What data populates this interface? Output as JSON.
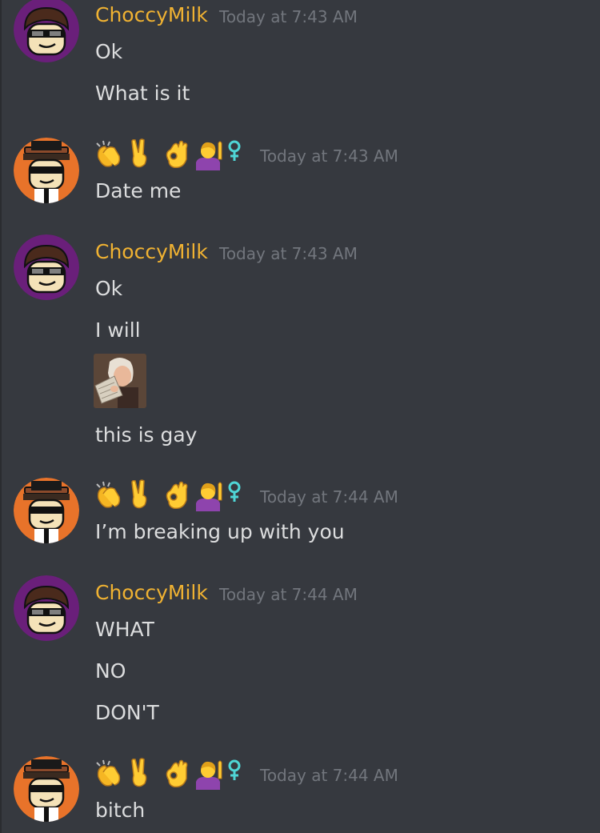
{
  "users": {
    "choccy": {
      "name": "ChoccyMilk",
      "color": "#f0b232"
    },
    "emoji": {
      "name_icons": [
        "clapping-hands",
        "victory-hand",
        "ok-hand",
        "person-raising-hand",
        "female-sign"
      ]
    }
  },
  "groups": [
    {
      "author": "ChoccyMilk",
      "time": "Today at 7:43 AM",
      "lines": [
        "Ok",
        "What is it"
      ]
    },
    {
      "time": "Today at 7:43 AM",
      "lines": [
        "Date me"
      ]
    },
    {
      "author": "ChoccyMilk",
      "time": "Today at 7:43 AM",
      "lines": [
        "Ok",
        "I will",
        "this is gay"
      ]
    },
    {
      "time": "Today at 7:44 AM",
      "lines": [
        "I’m breaking up with you"
      ]
    },
    {
      "author": "ChoccyMilk",
      "time": "Today at 7:44 AM",
      "lines": [
        "WHAT",
        "NO",
        "DON'T"
      ]
    },
    {
      "time": "Today at 7:44 AM",
      "lines": [
        "bitch"
      ]
    }
  ],
  "colors": {
    "background": "#36393f",
    "text": "#dcddde",
    "timestamp": "#72767d",
    "author": "#f0b232",
    "female_sign": "#4fd6d6"
  }
}
